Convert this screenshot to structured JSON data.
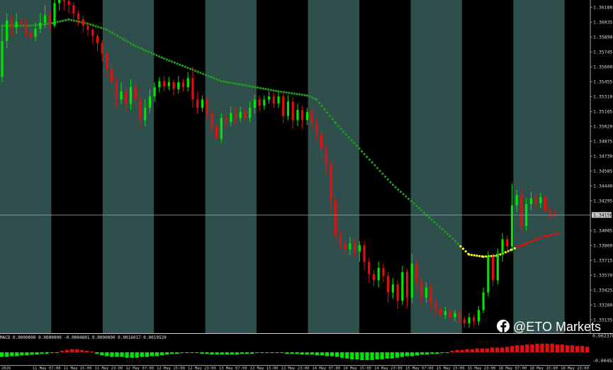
{
  "colors": {
    "band_light": "#2f4f4c",
    "band_dark": "#000000",
    "bull": "#00e600",
    "bear": "#e01010",
    "ma_down": "#1f9a1f",
    "ma_flat": "#ffff33",
    "ma_up": "#e01010",
    "axis_bg": "#000000",
    "text": "#d8d8d8"
  },
  "watermark": {
    "icon": "facebook-icon",
    "text": "@ETO Markets"
  },
  "macd": {
    "label": "MACD 0.0000000 0.0000000 -0.0004801 0.0000000 0.0016017 0.0019520",
    "top_value": "0.0023706",
    "bottom_value": "-0.004537"
  },
  "price_axis": {
    "labels": [
      "1.36180",
      "1.36035",
      "1.35890",
      "1.35745",
      "1.35600",
      "1.35455",
      "1.35310",
      "1.35165",
      "1.35020",
      "1.34875",
      "1.34730",
      "1.34585",
      "1.34440",
      "1.34295",
      "1.34150",
      "1.34005",
      "1.33860",
      "1.33715",
      "1.33570",
      "1.33425",
      "1.33280",
      "1.33135"
    ],
    "current": "1.34156"
  },
  "time_axis": {
    "labels": [
      "2026",
      "11 May 07:00",
      "11 May 15:00",
      "11 May 23:00",
      "12 May 07:00",
      "12 May 15:00",
      "12 May 23:00",
      "13 May 07:00",
      "13 May 15:00",
      "13 May 23:00",
      "14 May 07:00",
      "14 May 15:00",
      "14 May 23:00",
      "15 May 07:00",
      "15 May 15:00",
      "15 May 23:00",
      "18 May 07:00",
      "18 May 15:00",
      "18 May 23:00"
    ]
  },
  "chart_data": {
    "type": "candlestick",
    "timeframe": "hourly",
    "price_range": [
      1.3306,
      1.3625
    ],
    "overlay": "moving average (dotted)",
    "candles": [
      {
        "o": 1.355,
        "c": 1.3585,
        "h": 1.36,
        "l": 1.3545
      },
      {
        "o": 1.3585,
        "c": 1.3605,
        "h": 1.3612,
        "l": 1.3578
      },
      {
        "o": 1.3605,
        "c": 1.3598,
        "h": 1.361,
        "l": 1.359
      },
      {
        "o": 1.3598,
        "c": 1.3604,
        "h": 1.3612,
        "l": 1.3592
      },
      {
        "o": 1.3604,
        "c": 1.3602,
        "h": 1.3608,
        "l": 1.3595
      },
      {
        "o": 1.3602,
        "c": 1.3593,
        "h": 1.3606,
        "l": 1.3588
      },
      {
        "o": 1.3593,
        "c": 1.3589,
        "h": 1.3598,
        "l": 1.3583
      },
      {
        "o": 1.3589,
        "c": 1.3597,
        "h": 1.3603,
        "l": 1.3585
      },
      {
        "o": 1.3597,
        "c": 1.3603,
        "h": 1.3612,
        "l": 1.3593
      },
      {
        "o": 1.3603,
        "c": 1.361,
        "h": 1.362,
        "l": 1.3598
      },
      {
        "o": 1.361,
        "c": 1.36,
        "h": 1.3615,
        "l": 1.3595
      },
      {
        "o": 1.36,
        "c": 1.3622,
        "h": 1.3625,
        "l": 1.3598
      },
      {
        "o": 1.3622,
        "c": 1.3625,
        "h": 1.3625,
        "l": 1.3615
      },
      {
        "o": 1.3625,
        "c": 1.3624,
        "h": 1.3625,
        "l": 1.3615
      },
      {
        "o": 1.3624,
        "c": 1.362,
        "h": 1.3625,
        "l": 1.3612
      },
      {
        "o": 1.362,
        "c": 1.3612,
        "h": 1.3623,
        "l": 1.3605
      },
      {
        "o": 1.3612,
        "c": 1.3606,
        "h": 1.3615,
        "l": 1.36
      },
      {
        "o": 1.3606,
        "c": 1.36,
        "h": 1.361,
        "l": 1.3594
      },
      {
        "o": 1.36,
        "c": 1.3596,
        "h": 1.3603,
        "l": 1.359
      },
      {
        "o": 1.3596,
        "c": 1.359,
        "h": 1.3598,
        "l": 1.3583
      },
      {
        "o": 1.359,
        "c": 1.3583,
        "h": 1.3592,
        "l": 1.3575
      },
      {
        "o": 1.3583,
        "c": 1.3573,
        "h": 1.3586,
        "l": 1.3565
      },
      {
        "o": 1.3573,
        "c": 1.3558,
        "h": 1.3576,
        "l": 1.355
      },
      {
        "o": 1.3558,
        "c": 1.3545,
        "h": 1.3562,
        "l": 1.3538
      },
      {
        "o": 1.3545,
        "c": 1.3528,
        "h": 1.355,
        "l": 1.352
      },
      {
        "o": 1.3528,
        "c": 1.3536,
        "h": 1.3545,
        "l": 1.3524
      },
      {
        "o": 1.3536,
        "c": 1.3524,
        "h": 1.354,
        "l": 1.3516
      },
      {
        "o": 1.3524,
        "c": 1.354,
        "h": 1.3548,
        "l": 1.3518
      },
      {
        "o": 1.354,
        "c": 1.3528,
        "h": 1.3545,
        "l": 1.352
      },
      {
        "o": 1.3528,
        "c": 1.3508,
        "h": 1.3532,
        "l": 1.35
      },
      {
        "o": 1.3508,
        "c": 1.352,
        "h": 1.3528,
        "l": 1.3502
      },
      {
        "o": 1.352,
        "c": 1.3531,
        "h": 1.3538,
        "l": 1.3515
      },
      {
        "o": 1.3531,
        "c": 1.354,
        "h": 1.3545,
        "l": 1.3526
      },
      {
        "o": 1.354,
        "c": 1.3546,
        "h": 1.355,
        "l": 1.3535
      },
      {
        "o": 1.3546,
        "c": 1.3541,
        "h": 1.3551,
        "l": 1.3536
      },
      {
        "o": 1.3541,
        "c": 1.3545,
        "h": 1.355,
        "l": 1.3537
      },
      {
        "o": 1.3545,
        "c": 1.3538,
        "h": 1.3548,
        "l": 1.3532
      },
      {
        "o": 1.3538,
        "c": 1.3545,
        "h": 1.3551,
        "l": 1.3534
      },
      {
        "o": 1.3545,
        "c": 1.354,
        "h": 1.3548,
        "l": 1.3536
      },
      {
        "o": 1.354,
        "c": 1.3549,
        "h": 1.3555,
        "l": 1.3536
      },
      {
        "o": 1.3549,
        "c": 1.3528,
        "h": 1.356,
        "l": 1.352
      },
      {
        "o": 1.3528,
        "c": 1.352,
        "h": 1.3535,
        "l": 1.3514
      },
      {
        "o": 1.352,
        "c": 1.3528,
        "h": 1.3532,
        "l": 1.3516
      },
      {
        "o": 1.3528,
        "c": 1.3515,
        "h": 1.3531,
        "l": 1.3508
      },
      {
        "o": 1.3515,
        "c": 1.3502,
        "h": 1.3518,
        "l": 1.3496
      },
      {
        "o": 1.3502,
        "c": 1.349,
        "h": 1.3505,
        "l": 1.3484
      },
      {
        "o": 1.349,
        "c": 1.351,
        "h": 1.3515,
        "l": 1.3486
      },
      {
        "o": 1.351,
        "c": 1.3506,
        "h": 1.3516,
        "l": 1.35
      },
      {
        "o": 1.3506,
        "c": 1.3515,
        "h": 1.3521,
        "l": 1.3502
      },
      {
        "o": 1.3515,
        "c": 1.351,
        "h": 1.352,
        "l": 1.3504
      },
      {
        "o": 1.351,
        "c": 1.3516,
        "h": 1.3521,
        "l": 1.3506
      },
      {
        "o": 1.3516,
        "c": 1.351,
        "h": 1.352,
        "l": 1.3506
      },
      {
        "o": 1.351,
        "c": 1.352,
        "h": 1.3526,
        "l": 1.3506
      },
      {
        "o": 1.352,
        "c": 1.3528,
        "h": 1.3533,
        "l": 1.3514
      },
      {
        "o": 1.3528,
        "c": 1.3522,
        "h": 1.3532,
        "l": 1.3516
      },
      {
        "o": 1.3522,
        "c": 1.3528,
        "h": 1.3532,
        "l": 1.3518
      },
      {
        "o": 1.3528,
        "c": 1.3531,
        "h": 1.3536,
        "l": 1.3524
      },
      {
        "o": 1.3531,
        "c": 1.3524,
        "h": 1.3535,
        "l": 1.352
      },
      {
        "o": 1.3524,
        "c": 1.3531,
        "h": 1.3535,
        "l": 1.352
      },
      {
        "o": 1.3531,
        "c": 1.3512,
        "h": 1.3535,
        "l": 1.3505
      },
      {
        "o": 1.3512,
        "c": 1.3526,
        "h": 1.3532,
        "l": 1.3508
      },
      {
        "o": 1.3526,
        "c": 1.3508,
        "h": 1.353,
        "l": 1.35
      },
      {
        "o": 1.3508,
        "c": 1.3518,
        "h": 1.3524,
        "l": 1.3502
      },
      {
        "o": 1.3518,
        "c": 1.3508,
        "h": 1.3522,
        "l": 1.35
      },
      {
        "o": 1.3508,
        "c": 1.3516,
        "h": 1.352,
        "l": 1.3503
      },
      {
        "o": 1.3516,
        "c": 1.3505,
        "h": 1.352,
        "l": 1.3498
      },
      {
        "o": 1.3505,
        "c": 1.3494,
        "h": 1.351,
        "l": 1.3488
      },
      {
        "o": 1.3494,
        "c": 1.348,
        "h": 1.3498,
        "l": 1.347
      },
      {
        "o": 1.348,
        "c": 1.3465,
        "h": 1.3484,
        "l": 1.3455
      },
      {
        "o": 1.3465,
        "c": 1.343,
        "h": 1.347,
        "l": 1.342
      },
      {
        "o": 1.343,
        "c": 1.3395,
        "h": 1.3436,
        "l": 1.339
      },
      {
        "o": 1.3395,
        "c": 1.3388,
        "h": 1.34,
        "l": 1.3382
      },
      {
        "o": 1.3388,
        "c": 1.3382,
        "h": 1.3392,
        "l": 1.3375
      },
      {
        "o": 1.3382,
        "c": 1.3388,
        "h": 1.3394,
        "l": 1.3376
      },
      {
        "o": 1.3388,
        "c": 1.338,
        "h": 1.3392,
        "l": 1.3375
      },
      {
        "o": 1.338,
        "c": 1.3386,
        "h": 1.339,
        "l": 1.337
      },
      {
        "o": 1.3386,
        "c": 1.337,
        "h": 1.339,
        "l": 1.3362
      },
      {
        "o": 1.337,
        "c": 1.3358,
        "h": 1.3374,
        "l": 1.335
      },
      {
        "o": 1.3358,
        "c": 1.3352,
        "h": 1.3362,
        "l": 1.3346
      },
      {
        "o": 1.3352,
        "c": 1.3364,
        "h": 1.337,
        "l": 1.3345
      },
      {
        "o": 1.3364,
        "c": 1.3356,
        "h": 1.3368,
        "l": 1.335
      },
      {
        "o": 1.3356,
        "c": 1.334,
        "h": 1.336,
        "l": 1.333
      },
      {
        "o": 1.334,
        "c": 1.3348,
        "h": 1.3354,
        "l": 1.3334
      },
      {
        "o": 1.3348,
        "c": 1.3332,
        "h": 1.3352,
        "l": 1.3324
      },
      {
        "o": 1.3332,
        "c": 1.336,
        "h": 1.3366,
        "l": 1.3328
      },
      {
        "o": 1.336,
        "c": 1.3335,
        "h": 1.3363,
        "l": 1.3325
      },
      {
        "o": 1.3335,
        "c": 1.3368,
        "h": 1.3378,
        "l": 1.333
      },
      {
        "o": 1.3368,
        "c": 1.335,
        "h": 1.3372,
        "l": 1.334
      },
      {
        "o": 1.335,
        "c": 1.3335,
        "h": 1.3354,
        "l": 1.3328
      },
      {
        "o": 1.3335,
        "c": 1.3345,
        "h": 1.335,
        "l": 1.333
      },
      {
        "o": 1.3345,
        "c": 1.333,
        "h": 1.3349,
        "l": 1.3322
      },
      {
        "o": 1.333,
        "c": 1.3324,
        "h": 1.3334,
        "l": 1.3318
      },
      {
        "o": 1.3324,
        "c": 1.3318,
        "h": 1.3328,
        "l": 1.3313
      },
      {
        "o": 1.3318,
        "c": 1.3322,
        "h": 1.3326,
        "l": 1.3314
      },
      {
        "o": 1.3322,
        "c": 1.3316,
        "h": 1.3325,
        "l": 1.3312
      },
      {
        "o": 1.3316,
        "c": 1.332,
        "h": 1.3323,
        "l": 1.3312
      },
      {
        "o": 1.332,
        "c": 1.3314,
        "h": 1.3323,
        "l": 1.331
      },
      {
        "o": 1.3314,
        "c": 1.331,
        "h": 1.3317,
        "l": 1.3306
      },
      {
        "o": 1.331,
        "c": 1.3316,
        "h": 1.332,
        "l": 1.3306
      },
      {
        "o": 1.3316,
        "c": 1.3312,
        "h": 1.3319,
        "l": 1.3307
      },
      {
        "o": 1.3312,
        "c": 1.3323,
        "h": 1.3327,
        "l": 1.3308
      },
      {
        "o": 1.3323,
        "c": 1.334,
        "h": 1.3345,
        "l": 1.332
      },
      {
        "o": 1.334,
        "c": 1.3375,
        "h": 1.338,
        "l": 1.3336
      },
      {
        "o": 1.3375,
        "c": 1.3352,
        "h": 1.3378,
        "l": 1.3346
      },
      {
        "o": 1.3352,
        "c": 1.3378,
        "h": 1.3383,
        "l": 1.3348
      },
      {
        "o": 1.3378,
        "c": 1.3392,
        "h": 1.3398,
        "l": 1.337
      },
      {
        "o": 1.3392,
        "c": 1.3385,
        "h": 1.3396,
        "l": 1.3378
      },
      {
        "o": 1.3385,
        "c": 1.3425,
        "h": 1.3446,
        "l": 1.338
      },
      {
        "o": 1.3425,
        "c": 1.3435,
        "h": 1.344,
        "l": 1.3418
      },
      {
        "o": 1.3435,
        "c": 1.3405,
        "h": 1.344,
        "l": 1.3398
      },
      {
        "o": 1.3405,
        "c": 1.3426,
        "h": 1.3432,
        "l": 1.34
      },
      {
        "o": 1.3426,
        "c": 1.3432,
        "h": 1.3438,
        "l": 1.342
      },
      {
        "o": 1.3432,
        "c": 1.3427,
        "h": 1.3436,
        "l": 1.3422
      },
      {
        "o": 1.3427,
        "c": 1.3433,
        "h": 1.3437,
        "l": 1.3422
      },
      {
        "o": 1.3433,
        "c": 1.342,
        "h": 1.3436,
        "l": 1.3414
      },
      {
        "o": 1.342,
        "c": 1.3418,
        "h": 1.3424,
        "l": 1.3412
      },
      {
        "o": 1.3418,
        "c": 1.3416,
        "h": 1.3421,
        "l": 1.3413
      }
    ],
    "ma": [
      {
        "i": 0,
        "v": 1.36
      },
      {
        "i": 6,
        "v": 1.36
      },
      {
        "i": 10,
        "v": 1.3602
      },
      {
        "i": 14,
        "v": 1.3606
      },
      {
        "i": 18,
        "v": 1.3602
      },
      {
        "i": 22,
        "v": 1.3596
      },
      {
        "i": 28,
        "v": 1.358
      },
      {
        "i": 34,
        "v": 1.3568
      },
      {
        "i": 40,
        "v": 1.3557
      },
      {
        "i": 46,
        "v": 1.3546
      },
      {
        "i": 52,
        "v": 1.3541
      },
      {
        "i": 58,
        "v": 1.3536
      },
      {
        "i": 64,
        "v": 1.3532
      },
      {
        "i": 66,
        "v": 1.3528
      },
      {
        "i": 70,
        "v": 1.3505
      },
      {
        "i": 76,
        "v": 1.3475
      },
      {
        "i": 82,
        "v": 1.3445
      },
      {
        "i": 88,
        "v": 1.342
      },
      {
        "i": 94,
        "v": 1.3395
      },
      {
        "i": 98,
        "v": 1.3377
      },
      {
        "i": 101,
        "v": 1.3375
      },
      {
        "i": 104,
        "v": 1.3376
      },
      {
        "i": 107,
        "v": 1.3382
      },
      {
        "i": 110,
        "v": 1.3388
      },
      {
        "i": 114,
        "v": 1.3395
      },
      {
        "i": 117,
        "v": 1.3398
      }
    ],
    "ma_segments": {
      "flat_start": 96,
      "up_start": 108
    },
    "macd_hist": [
      -6,
      -6,
      -5,
      -5,
      -4,
      -4,
      -3,
      -3,
      -2,
      -2,
      -1,
      -1,
      2,
      3,
      4,
      4,
      3,
      2,
      1,
      -2,
      -4,
      -5,
      -6,
      -6,
      -6,
      -7,
      -7,
      -7,
      -6,
      -6,
      -5,
      -5,
      -4,
      -3,
      -2,
      -2,
      -1,
      -1,
      -1,
      -1,
      -2,
      -2,
      -3,
      -3,
      -3,
      -3,
      -3,
      -3,
      -2,
      -2,
      -2,
      -1,
      -1,
      -1,
      -1,
      -1,
      -1,
      -2,
      -2,
      -2,
      -3,
      -3,
      -3,
      -4,
      -4,
      -5,
      -5,
      -6,
      -7,
      -8,
      -9,
      -9,
      -10,
      -10,
      -10,
      -9,
      -9,
      -8,
      -8,
      -7,
      -6,
      -5,
      -5,
      -4,
      -3,
      -3,
      -2,
      -2,
      -1,
      -1,
      2,
      3,
      3,
      4,
      4,
      5,
      5,
      5,
      6,
      6,
      6,
      7,
      8,
      9,
      9,
      10,
      10,
      11,
      11,
      11,
      11,
      10,
      10,
      9,
      9,
      8,
      8,
      7
    ],
    "macd_zero_fraction": 0.5
  }
}
